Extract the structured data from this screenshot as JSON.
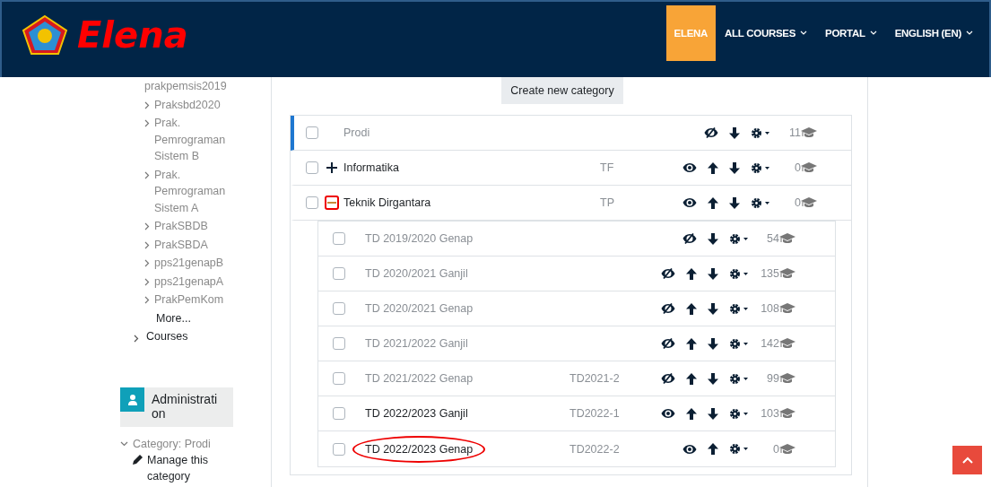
{
  "header": {
    "brand": "Elena",
    "nav": [
      {
        "label": "ELENA",
        "selected": true,
        "dropdown": false
      },
      {
        "label": "ALL COURSES",
        "selected": false,
        "dropdown": true
      },
      {
        "label": "PORTAL",
        "selected": false,
        "dropdown": true
      },
      {
        "label": "ENGLISH (EN)",
        "selected": false,
        "dropdown": true
      }
    ]
  },
  "sidebar": {
    "tree": [
      {
        "label": "prakpemsis2019",
        "expandable": false
      },
      {
        "label": "Praksbd2020",
        "expandable": true
      },
      {
        "label": "Prak. Pemrograman Sistem B",
        "expandable": true
      },
      {
        "label": "Prak. Pemrograman Sistem A",
        "expandable": true
      },
      {
        "label": "PrakSBDB",
        "expandable": true
      },
      {
        "label": "PrakSBDA",
        "expandable": true
      },
      {
        "label": "pps21genapB",
        "expandable": true
      },
      {
        "label": "pps21genapA",
        "expandable": true
      },
      {
        "label": "PrakPemKom",
        "expandable": true
      },
      {
        "label": "More...",
        "expandable": false
      }
    ],
    "sibling": {
      "label": "Courses",
      "expandable": true
    },
    "admin": {
      "title": "Administration",
      "category": {
        "label": "Category: Prodi",
        "expanded": true
      },
      "link": "Manage this category"
    }
  },
  "main": {
    "create_button": "Create new category",
    "categories": [
      {
        "name": "Prodi",
        "checked": false,
        "visible": false,
        "selected": true,
        "expandable": false,
        "can_move_up": false,
        "can_move_down": true,
        "count": "11"
      },
      {
        "name": "Informatika",
        "idnumber": "TF",
        "checked": false,
        "visible": true,
        "selected": false,
        "expandable": true,
        "expanded": false,
        "marked": false,
        "can_move_up": true,
        "can_move_down": true,
        "count": "0"
      },
      {
        "name": "Teknik Dirgantara",
        "idnumber": "TP",
        "checked": false,
        "visible": true,
        "selected": false,
        "expandable": true,
        "expanded": true,
        "marked": true,
        "can_move_up": true,
        "can_move_down": true,
        "count": "0",
        "children": [
          {
            "name": "TD 2019/2020 Genap",
            "checked": false,
            "visible": false,
            "marked": false,
            "can_move_up": false,
            "can_move_down": true,
            "count": "54"
          },
          {
            "name": "TD 2020/2021 Ganjil",
            "checked": false,
            "visible": false,
            "marked": false,
            "can_move_up": true,
            "can_move_down": true,
            "count": "135"
          },
          {
            "name": "TD 2020/2021 Genap",
            "checked": false,
            "visible": false,
            "marked": false,
            "can_move_up": true,
            "can_move_down": true,
            "count": "108"
          },
          {
            "name": "TD 2021/2022 Ganjil",
            "checked": false,
            "visible": false,
            "marked": false,
            "can_move_up": true,
            "can_move_down": true,
            "count": "142"
          },
          {
            "name": "TD 2021/2022 Genap",
            "idnumber": "TD2021-2",
            "checked": false,
            "visible": false,
            "marked": false,
            "can_move_up": true,
            "can_move_down": true,
            "count": "99"
          },
          {
            "name": "TD 2022/2023 Ganjil",
            "idnumber": "TD2022-1",
            "checked": false,
            "visible": true,
            "marked": false,
            "can_move_up": true,
            "can_move_down": true,
            "count": "103"
          },
          {
            "name": "TD 2022/2023 Genap",
            "idnumber": "TD2022-2",
            "checked": false,
            "visible": true,
            "marked": true,
            "can_move_up": true,
            "can_move_down": false,
            "count": "0"
          }
        ]
      }
    ]
  }
}
